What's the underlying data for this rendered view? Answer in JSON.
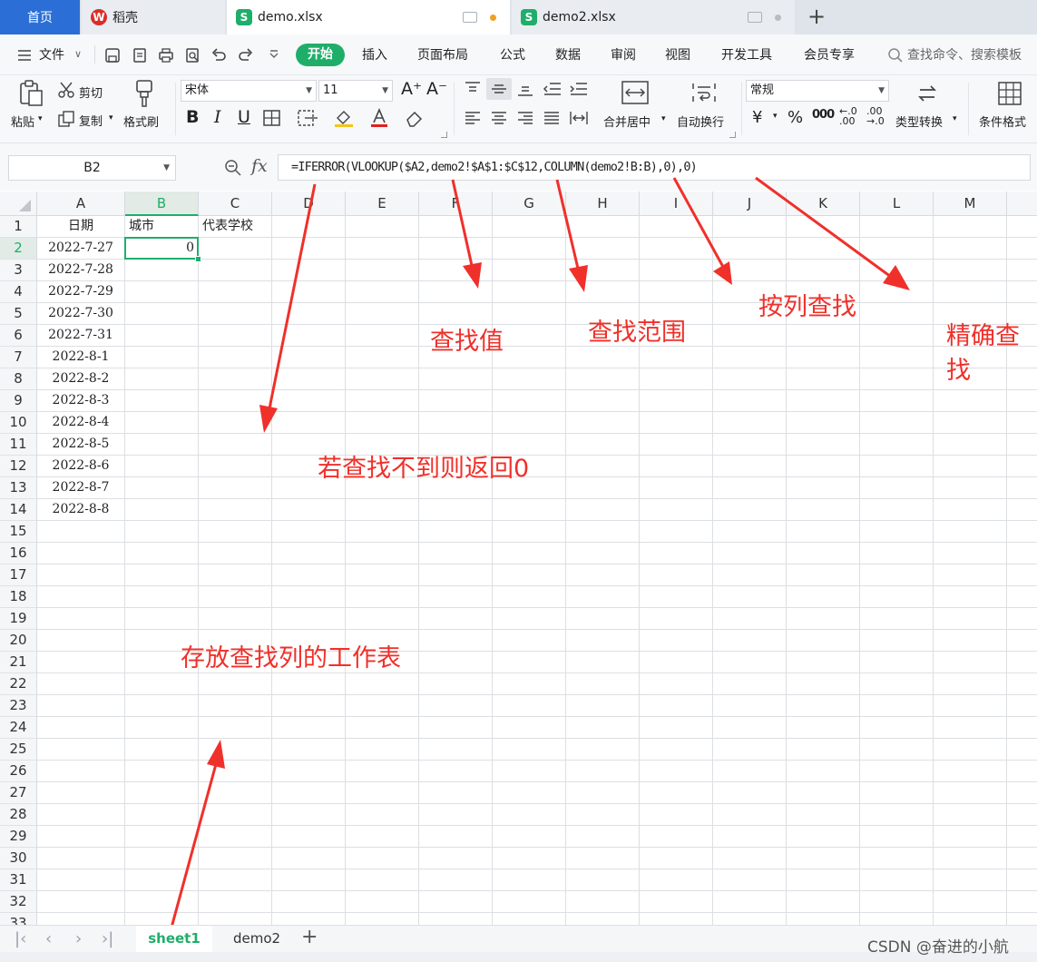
{
  "tabs": {
    "home": "首页",
    "daoke": "稻壳",
    "doc1": "demo.xlsx",
    "doc2": "demo2.xlsx",
    "add": "+",
    "colors": {
      "home_bg": "#2b6fd6",
      "sheet_icon": "#1fae6a",
      "daoke_icon": "#d8302a",
      "unsaved_dot": "#f0a020"
    }
  },
  "menu": {
    "file": "文件",
    "items": [
      "开始",
      "插入",
      "页面布局",
      "公式",
      "数据",
      "审阅",
      "视图",
      "开发工具",
      "会员专享"
    ],
    "search_placeholder": "查找命令、搜索模板",
    "accent": "#1fae6a"
  },
  "ribbon": {
    "paste": "粘贴",
    "cut": "剪切",
    "copy": "复制",
    "format_painter": "格式刷",
    "font_name": "宋体",
    "font_size": "11",
    "merge_center": "合并居中",
    "wrap_text": "自动换行",
    "number_format": "常规",
    "convert_type": "类型转换",
    "conditional_format": "条件格式",
    "currency_symbol": "¥",
    "percent_symbol": "%"
  },
  "formula_bar": {
    "name_box": "B2",
    "fx": "fx",
    "formula": "=IFERROR(VLOOKUP($A2,demo2!$A$1:$C$12,COLUMN(demo2!B:B),0),0)"
  },
  "grid": {
    "columns": [
      "A",
      "B",
      "C",
      "D",
      "E",
      "F",
      "G",
      "H",
      "I",
      "J",
      "K",
      "L",
      "M"
    ],
    "selected_column": "B",
    "selected_row": "2",
    "rows": [
      "1",
      "2",
      "3",
      "4",
      "5",
      "6",
      "7",
      "8",
      "9",
      "10",
      "11",
      "12",
      "13",
      "14",
      "15",
      "16",
      "17",
      "18",
      "19",
      "20",
      "21",
      "22",
      "23",
      "24",
      "25",
      "26",
      "27",
      "28",
      "29",
      "30",
      "31",
      "32",
      "33"
    ],
    "header_row": [
      "日期",
      "城市",
      "代表学校"
    ],
    "dates": [
      "2022-7-27",
      "2022-7-28",
      "2022-7-29",
      "2022-7-30",
      "2022-7-31",
      "2022-8-1",
      "2022-8-2",
      "2022-8-3",
      "2022-8-4",
      "2022-8-5",
      "2022-8-6",
      "2022-8-7",
      "2022-8-8"
    ],
    "b2_value": "0"
  },
  "annotations": {
    "lookup_value": "查找值",
    "lookup_range": "查找范围",
    "by_column": "按列查找",
    "exact_match": "精确查找",
    "return_zero": "若查找不到则返回0",
    "sheet_note": "存放查找列的工作表",
    "color": "#f0302a"
  },
  "sheets": {
    "tabs": [
      "sheet1",
      "demo2"
    ],
    "active": "sheet1",
    "add": "+"
  },
  "watermark": "CSDN @奋进的小航"
}
